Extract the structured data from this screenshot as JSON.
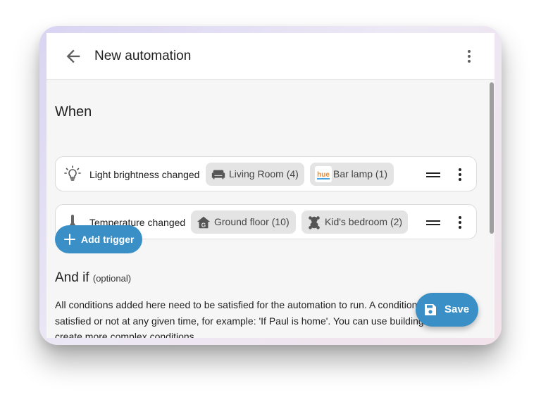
{
  "header": {
    "title": "New automation",
    "back_icon": "arrow-left-icon",
    "menu_icon": "dots-vertical-icon"
  },
  "when": {
    "heading": "When",
    "triggers": [
      {
        "label": "Light brightness changed",
        "icon": "lightbulb-icon",
        "targets": [
          {
            "label": "Living Room (4)",
            "icon": "sofa-icon"
          },
          {
            "label": "Bar lamp (1)",
            "icon": "hue-logo-icon",
            "logo_text": "hue"
          }
        ]
      },
      {
        "label": "Temperature changed",
        "icon": "thermometer-icon",
        "targets": [
          {
            "label": "Ground floor (10)",
            "icon": "home-floor-icon"
          },
          {
            "label": "Kid's bedroom (2)",
            "icon": "teddy-bear-icon"
          }
        ]
      }
    ],
    "add_trigger_label": "Add trigger"
  },
  "and_if": {
    "heading": "And if",
    "optional_label": "(optional)",
    "description": "All conditions added here need to be satisfied for the automation to run. A condition can be satisfied or not at any given time, for example: 'If Paul is home'. You can use building blocks to create more complex conditions."
  },
  "save_label": "Save",
  "colors": {
    "accent": "#3a8fc6",
    "background": "#f6f6f6",
    "chip": "#e4e4e4"
  }
}
